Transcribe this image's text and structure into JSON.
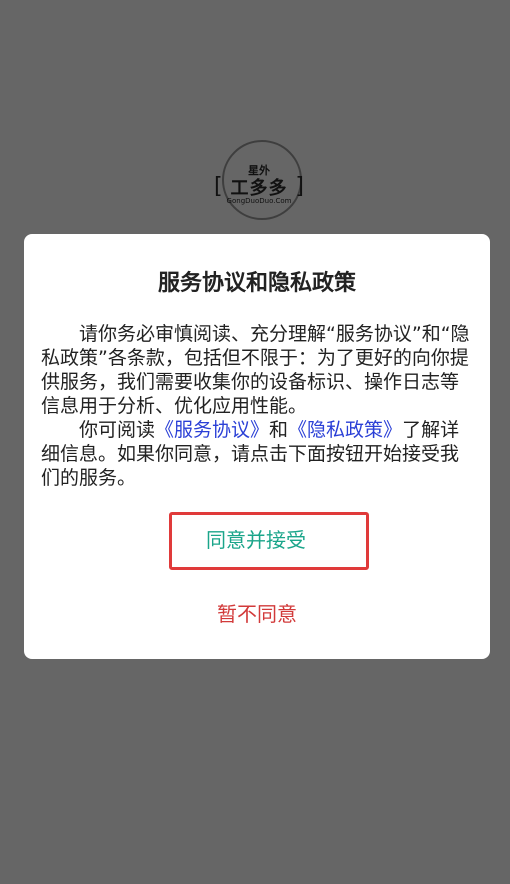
{
  "logo": {
    "top_text": "星外",
    "main_text": "工多多",
    "domain": "GongDuoDuo.Com",
    "bracket_left": "[",
    "bracket_right": "]"
  },
  "dialog": {
    "title": "服务协议和隐私政策",
    "paragraph1": "请你务必审慎阅读、充分理解“服务协议”和“隐私政策”各条款，包括但不限于：为了更好的向你提供服务，我们需要收集你的设备标识、操作日志等信息用于分析、优化应用性能。",
    "paragraph2_prefix": "你可阅读",
    "link_service": "《服务协议》",
    "paragraph2_and": "和",
    "link_privacy": "《隐私政策》",
    "paragraph2_suffix": "了解详细信息。如果你同意，请点击下面按钮开始接受我们的服务。",
    "accept_label": "同意并接受",
    "decline_label": "暂不同意"
  },
  "colors": {
    "overlay": "#666666",
    "link": "#2a3fd6",
    "accept_text": "#1aa58a",
    "accept_border": "#e03a3a",
    "decline_text": "#d23a3a"
  }
}
